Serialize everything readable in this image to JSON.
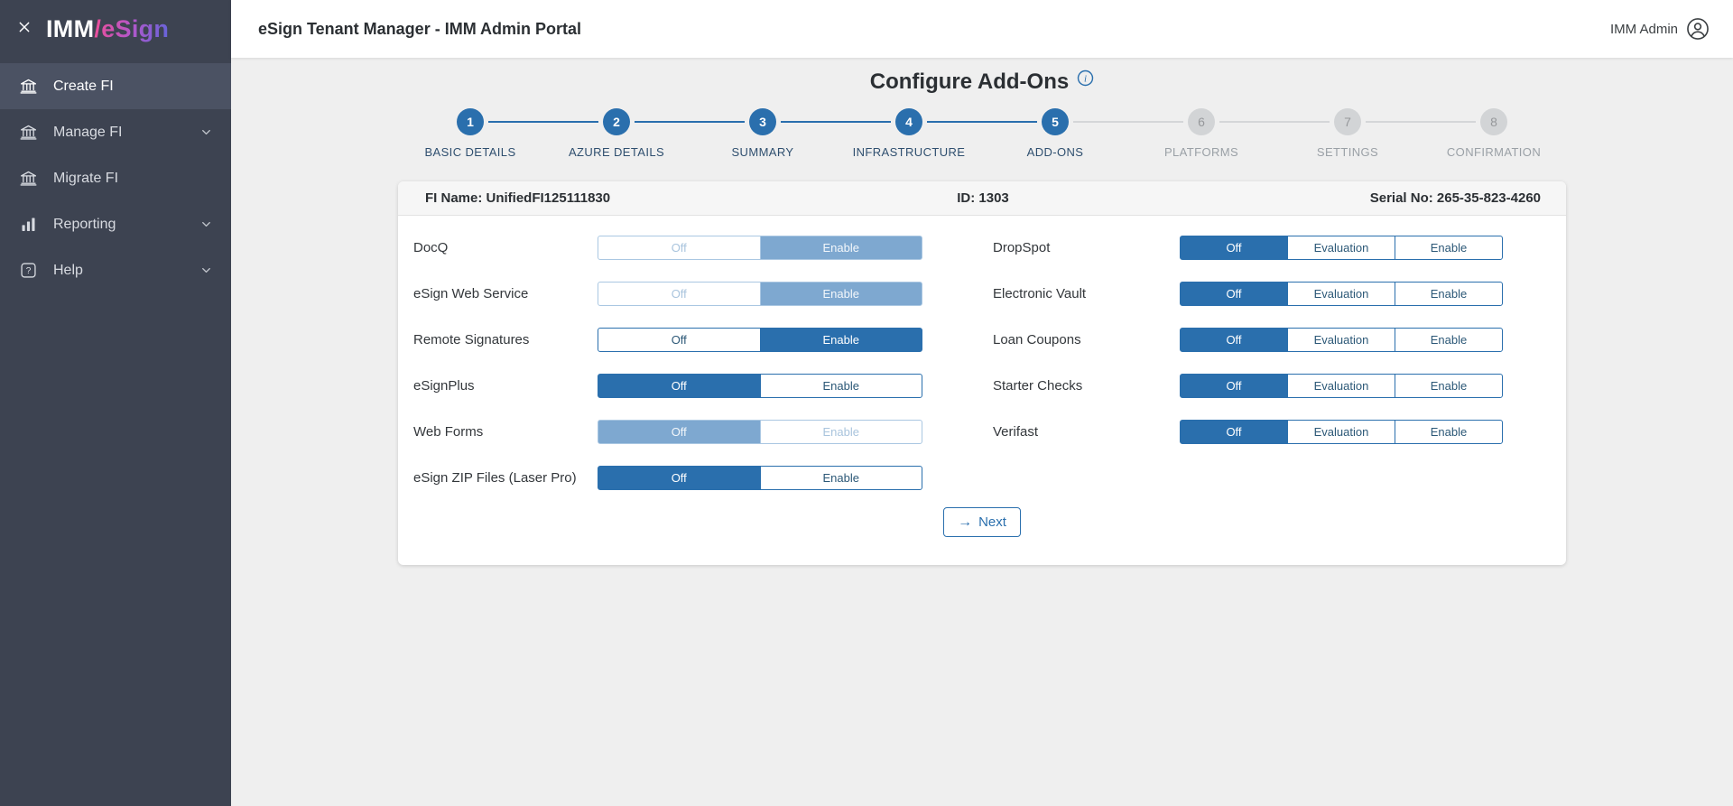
{
  "sidebar": {
    "logo": {
      "imm": "IMM",
      "rest": "/eSign"
    },
    "items": [
      {
        "label": "Create FI",
        "icon": "bank-icon",
        "active": true,
        "expandable": false
      },
      {
        "label": "Manage FI",
        "icon": "bank-icon",
        "active": false,
        "expandable": true
      },
      {
        "label": "Migrate FI",
        "icon": "bank-icon",
        "active": false,
        "expandable": false
      },
      {
        "label": "Reporting",
        "icon": "bar-chart-icon",
        "active": false,
        "expandable": true
      },
      {
        "label": "Help",
        "icon": "help-icon",
        "active": false,
        "expandable": true
      }
    ]
  },
  "header": {
    "title": "eSign Tenant Manager - IMM Admin Portal",
    "user": "IMM Admin"
  },
  "page": {
    "title": "Configure Add-Ons"
  },
  "stepper": {
    "steps": [
      {
        "num": "1",
        "label": "BASIC DETAILS",
        "state": "done"
      },
      {
        "num": "2",
        "label": "AZURE DETAILS",
        "state": "done"
      },
      {
        "num": "3",
        "label": "SUMMARY",
        "state": "done"
      },
      {
        "num": "4",
        "label": "INFRASTRUCTURE",
        "state": "done"
      },
      {
        "num": "5",
        "label": "ADD-ONS",
        "state": "active"
      },
      {
        "num": "6",
        "label": "PLATFORMS",
        "state": "upcoming"
      },
      {
        "num": "7",
        "label": "SETTINGS",
        "state": "upcoming"
      },
      {
        "num": "8",
        "label": "CONFIRMATION",
        "state": "upcoming"
      }
    ]
  },
  "fi_info": {
    "fi_name": "FI Name: UnifiedFI125111830",
    "id": "ID: 1303",
    "serial": "Serial No: 265-35-823-4260"
  },
  "addons": {
    "left_column": [
      {
        "label": "DocQ",
        "options": [
          "Off",
          "Enable"
        ],
        "selected": "Enable",
        "disabled": true
      },
      {
        "label": "eSign Web Service",
        "options": [
          "Off",
          "Enable"
        ],
        "selected": "Enable",
        "disabled": true
      },
      {
        "label": "Remote Signatures",
        "options": [
          "Off",
          "Enable"
        ],
        "selected": "Enable",
        "disabled": false
      },
      {
        "label": "eSignPlus",
        "options": [
          "Off",
          "Enable"
        ],
        "selected": "Off",
        "disabled": false
      },
      {
        "label": "Web Forms",
        "options": [
          "Off",
          "Enable"
        ],
        "selected": "Off",
        "disabled": true
      },
      {
        "label": "eSign ZIP Files (Laser Pro)",
        "options": [
          "Off",
          "Enable"
        ],
        "selected": "Off",
        "disabled": false
      }
    ],
    "right_column": [
      {
        "label": "DropSpot",
        "options": [
          "Off",
          "Evaluation",
          "Enable"
        ],
        "selected": "Off",
        "disabled": false
      },
      {
        "label": "Electronic Vault",
        "options": [
          "Off",
          "Evaluation",
          "Enable"
        ],
        "selected": "Off",
        "disabled": false
      },
      {
        "label": "Loan Coupons",
        "options": [
          "Off",
          "Evaluation",
          "Enable"
        ],
        "selected": "Off",
        "disabled": false
      },
      {
        "label": "Starter Checks",
        "options": [
          "Off",
          "Evaluation",
          "Enable"
        ],
        "selected": "Off",
        "disabled": false
      },
      {
        "label": "Verifast",
        "options": [
          "Off",
          "Evaluation",
          "Enable"
        ],
        "selected": "Off",
        "disabled": false
      }
    ]
  },
  "next_button": {
    "arrow": "→",
    "label": "Next"
  },
  "colors": {
    "accent_blue": "#2a6fad",
    "disabled_blue": "#7ea8d0",
    "disabled_border": "#aac7e2",
    "sidebar_bg": "#3d4351",
    "sidebar_active_bg": "#4b5263",
    "logo_pink": "#e94f9b",
    "logo_purple": "#6b63d9",
    "step_gray": "#d2d4d6",
    "content_bg": "#efefef"
  }
}
